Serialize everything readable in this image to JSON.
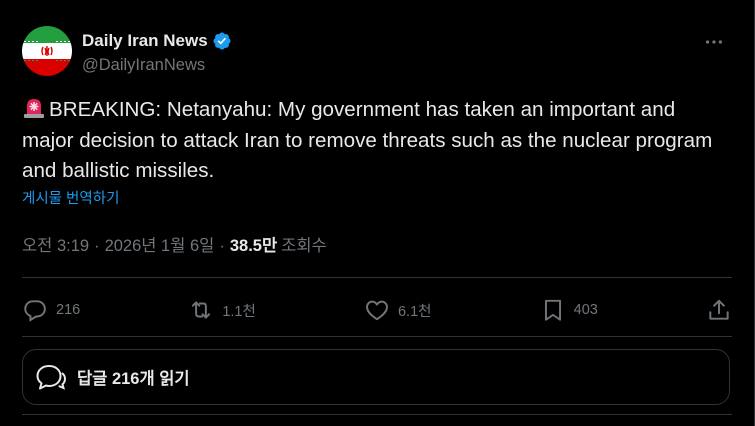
{
  "author": {
    "display_name": "Daily Iran News",
    "handle": "@DailyIranNews",
    "verified": true,
    "avatar_icon": "iran-flag-icon"
  },
  "more_icon": "more-horizontal-icon",
  "post": {
    "text": "BREAKING: Netanyahu: My government has taken an important and major decision to attack Iran to remove threats such as the nuclear program and ballistic missiles.",
    "emoji_icon": "rotating-light-icon",
    "translate_label": "게시물 번역하기"
  },
  "meta": {
    "time": "오전 3:19",
    "separator": "·",
    "date": "2026년 1월 6일",
    "views_count": "38.5만",
    "views_label": "조회수"
  },
  "actions": {
    "replies": "216",
    "reposts": "1.1천",
    "likes": "6.1천",
    "bookmarks": "403"
  },
  "read_replies": {
    "label": "답글 216개 읽기"
  },
  "colors": {
    "background": "#000000",
    "text": "#e7e9ea",
    "muted": "#71767b",
    "accent": "#1d9bf0",
    "border": "#2f3336"
  }
}
